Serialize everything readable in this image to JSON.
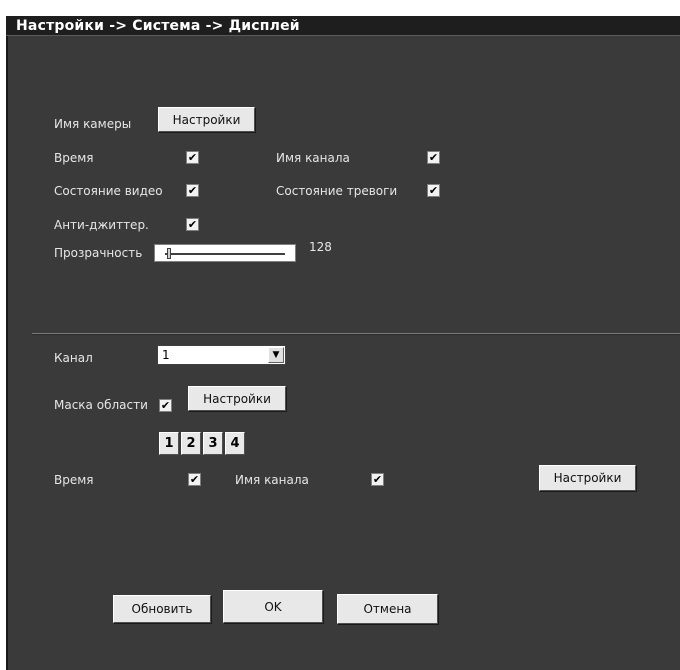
{
  "window": {
    "title": "Настройки -> Система -> Дисплей"
  },
  "general": {
    "camera_name_label": "Имя камеры",
    "camera_name_button": "Настройки",
    "time_label": "Время",
    "time_checked": true,
    "channel_name_label": "Имя канала",
    "channel_name_checked": true,
    "video_state_label": "Состояние видео",
    "video_state_checked": true,
    "alarm_state_label": "Состояние тревоги",
    "alarm_state_checked": true,
    "anti_jitter_label": "Анти-джиттер.",
    "anti_jitter_checked": true,
    "transparency_label": "Прозрачность",
    "transparency_value": "128"
  },
  "channel_section": {
    "channel_label": "Канал",
    "channel_selected": "1",
    "area_mask_label": "Маска области",
    "area_mask_checked": true,
    "area_mask_button": "Настройки",
    "area_tabs": [
      "1",
      "2",
      "3",
      "4"
    ],
    "time_label": "Время",
    "time_checked": true,
    "channel_name_label": "Имя канала",
    "channel_name_checked": true,
    "settings_button": "Настройки"
  },
  "footer": {
    "refresh_button": "Обновить",
    "ok_button": "OK",
    "cancel_button": "Отмена"
  },
  "checkmark": "✔"
}
